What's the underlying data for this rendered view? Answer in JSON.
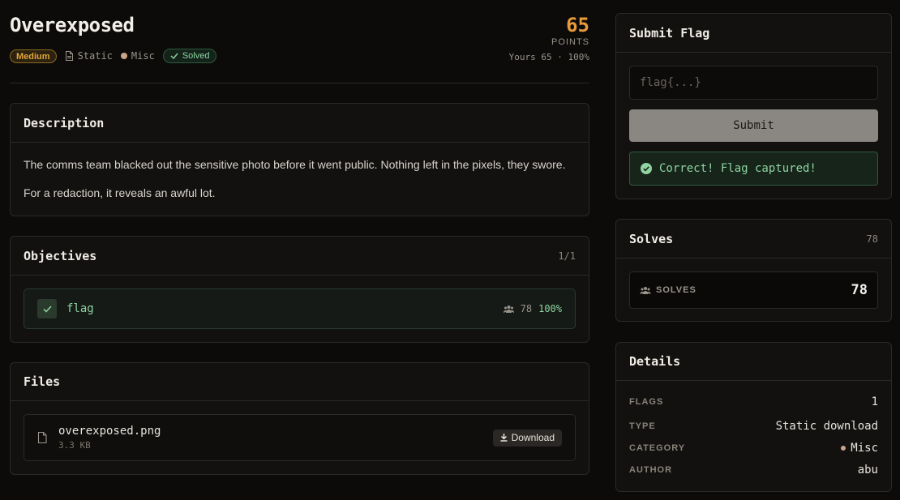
{
  "challenge": {
    "title": "Overexposed",
    "difficulty": "Medium",
    "type_label": "Static",
    "category": "Misc",
    "status": "Solved",
    "points": "65",
    "points_label": "POINTS",
    "yours": "Yours 65 · 100%"
  },
  "description": {
    "heading": "Description",
    "paragraphs": [
      "The comms team blacked out the sensitive photo before it went public. Nothing left in the pixels, they swore.",
      "For a redaction, it reveals an awful lot."
    ]
  },
  "objectives": {
    "heading": "Objectives",
    "count": "1/1",
    "items": [
      {
        "name": "flag",
        "solves": "78",
        "percent": "100%",
        "completed": true
      }
    ]
  },
  "files": {
    "heading": "Files",
    "items": [
      {
        "name": "overexposed.png",
        "size": "3.3 KB",
        "action": "Download"
      }
    ]
  },
  "submit": {
    "heading": "Submit Flag",
    "placeholder": "flag{...}",
    "button": "Submit",
    "success": "Correct! Flag captured!"
  },
  "solves": {
    "heading": "Solves",
    "count": "78",
    "label": "SOLVES",
    "value": "78"
  },
  "details": {
    "heading": "Details",
    "rows": [
      {
        "key": "FLAGS",
        "value": "1"
      },
      {
        "key": "TYPE",
        "value": "Static download"
      },
      {
        "key": "CATEGORY",
        "value": "Misc"
      },
      {
        "key": "AUTHOR",
        "value": "abu"
      }
    ]
  },
  "colors": {
    "accent": "#e89a3a",
    "success": "#8fd4a1",
    "background": "#0c0b0a"
  }
}
